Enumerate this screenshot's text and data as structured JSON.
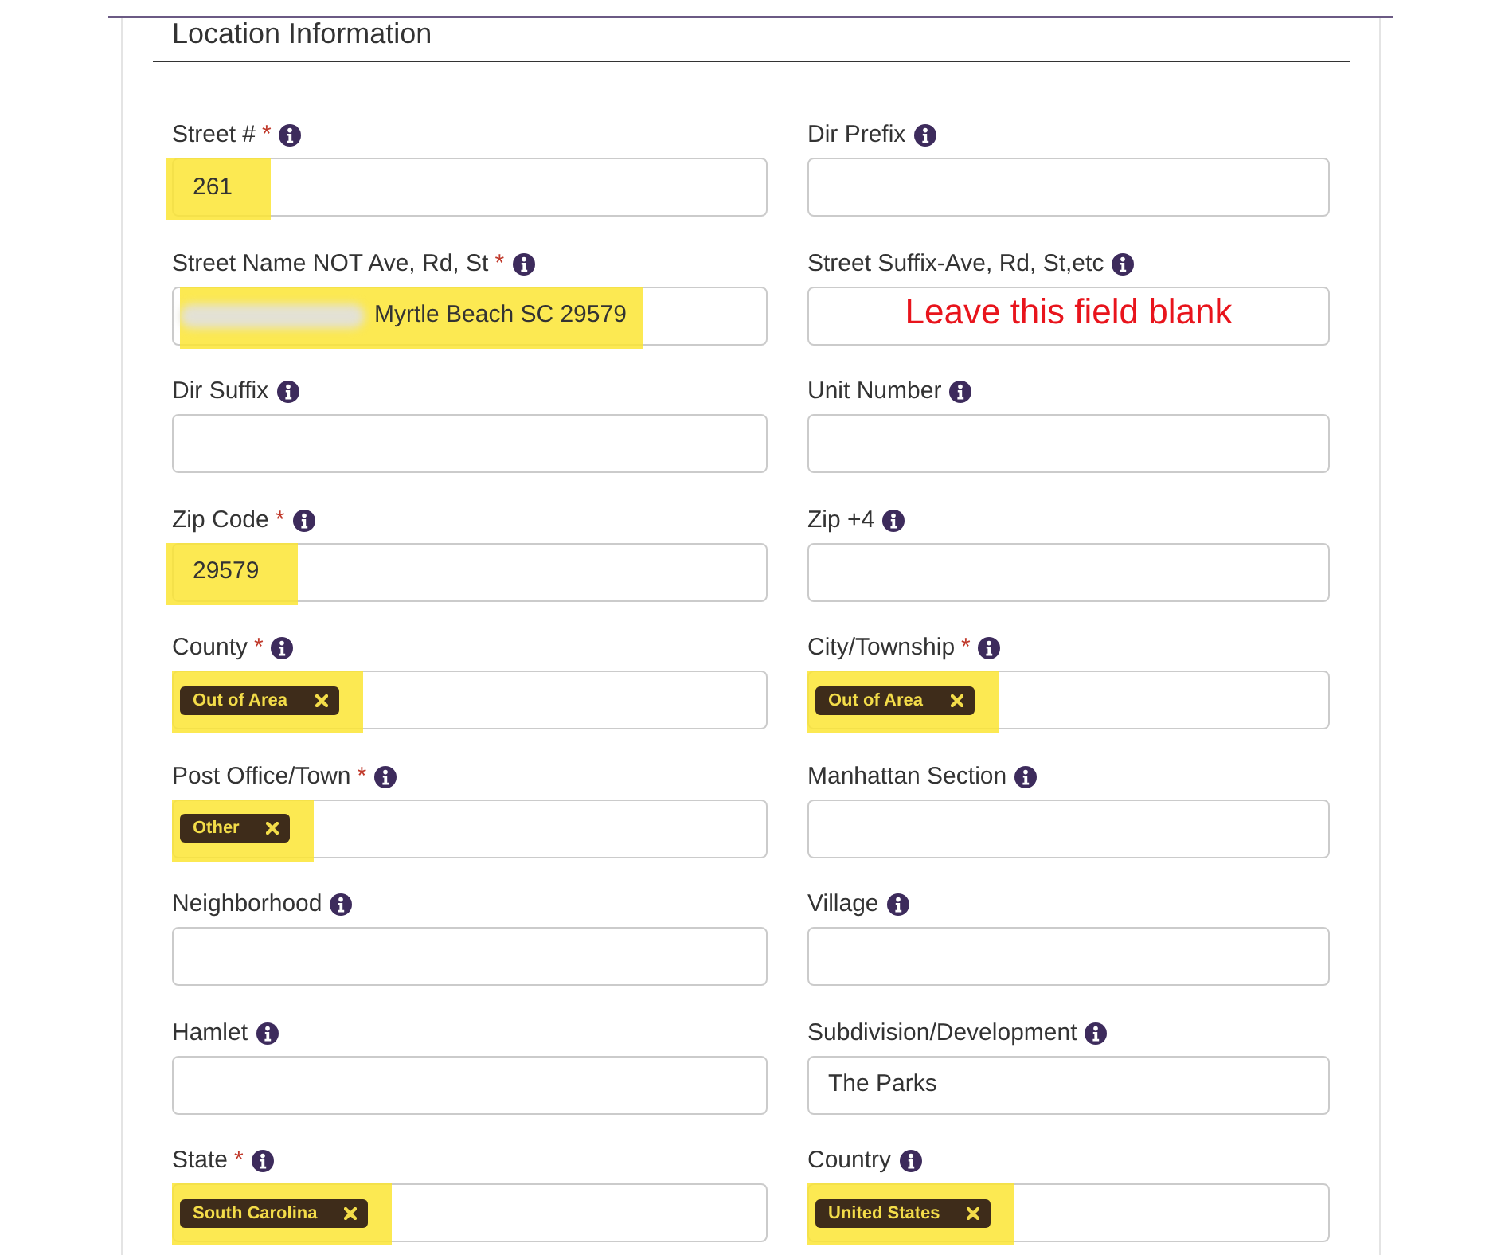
{
  "section": {
    "title": "Location Information"
  },
  "fields": [
    {
      "label": "Street #",
      "required_mark": "*",
      "kind": "text",
      "value": "261",
      "highlighted": true,
      "redacted": false
    },
    {
      "label": "Dir Prefix",
      "kind": "text",
      "highlighted": false,
      "redacted": false
    },
    {
      "label": "Street Name NOT Ave, Rd, St",
      "required_mark": "*",
      "kind": "text",
      "value": "Myrtle Beach SC 29579",
      "highlighted": true,
      "redacted": true
    },
    {
      "label": "Street Suffix-Ave, Rd, St,etc",
      "kind": "note",
      "note": "Leave this field blank",
      "highlighted": false
    },
    {
      "label": "Dir Suffix",
      "kind": "text",
      "highlighted": false,
      "redacted": false
    },
    {
      "label": "Unit Number",
      "kind": "text",
      "highlighted": false,
      "redacted": false
    },
    {
      "label": "Zip Code",
      "required_mark": "*",
      "kind": "text",
      "value": "29579",
      "highlighted": true,
      "redacted": false
    },
    {
      "label": "Zip +4",
      "kind": "text",
      "highlighted": false,
      "redacted": false
    },
    {
      "label": "County",
      "required_mark": "*",
      "kind": "tags",
      "tags": [
        "Out of Area"
      ],
      "highlighted": true
    },
    {
      "label": "City/Township",
      "required_mark": "*",
      "kind": "tags",
      "tags": [
        "Out of Area"
      ],
      "highlighted": true
    },
    {
      "label": "Post Office/Town",
      "required_mark": "*",
      "kind": "tags",
      "tags": [
        "Other"
      ],
      "highlighted": true
    },
    {
      "label": "Manhattan Section",
      "kind": "text",
      "highlighted": false,
      "redacted": false
    },
    {
      "label": "Neighborhood",
      "kind": "text",
      "highlighted": false,
      "redacted": false
    },
    {
      "label": "Village",
      "kind": "text",
      "highlighted": false,
      "redacted": false
    },
    {
      "label": "Hamlet",
      "kind": "text",
      "highlighted": false,
      "redacted": false
    },
    {
      "label": "Subdivision/Development",
      "kind": "text",
      "value": "The Parks",
      "highlighted": false,
      "redacted": false
    },
    {
      "label": "State",
      "required_mark": "*",
      "kind": "tags",
      "tags": [
        "South Carolina"
      ],
      "highlighted": true
    },
    {
      "label": "Country",
      "kind": "tags",
      "tags": [
        "United States"
      ],
      "highlighted": true
    }
  ]
}
